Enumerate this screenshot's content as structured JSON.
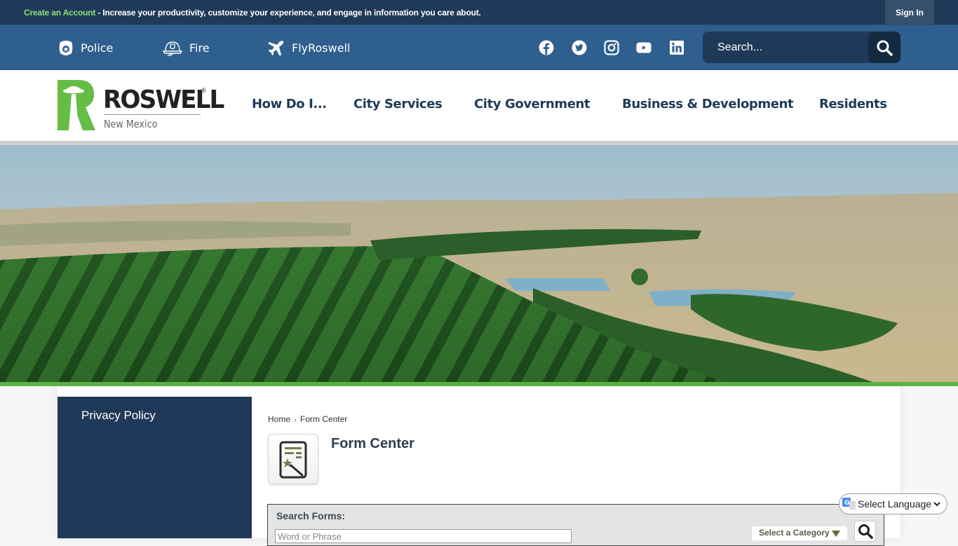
{
  "topbar": {
    "create_account_link": "Create an Account",
    "message": " - Increase your productivity, customize your experience, and engage in information you care about.",
    "sign_in_label": "Sign In"
  },
  "quicklinks": [
    {
      "label": "Police",
      "icon": "police-badge-icon"
    },
    {
      "label": "Fire",
      "icon": "fire-helmet-icon"
    },
    {
      "label": "FlyRoswell",
      "icon": "airplane-icon"
    }
  ],
  "social": [
    {
      "name": "facebook-icon"
    },
    {
      "name": "twitter-icon"
    },
    {
      "name": "instagram-icon"
    },
    {
      "name": "youtube-icon"
    },
    {
      "name": "linkedin-icon"
    }
  ],
  "search": {
    "placeholder": "Search...",
    "button_icon": "search-icon"
  },
  "logo": {
    "name": "ROSWELL",
    "subtitle": "New Mexico",
    "registered": "®"
  },
  "nav": [
    {
      "label": "How Do I..."
    },
    {
      "label": "City Services"
    },
    {
      "label": "City Government"
    },
    {
      "label": "Business & Development"
    },
    {
      "label": "Residents"
    }
  ],
  "colors": {
    "topbar": "#1f3a58",
    "utilbar": "#2e5f8e",
    "accent_green": "#5db446",
    "nav_text": "#1f3a58"
  },
  "sidebar": {
    "items": [
      {
        "label": "Privacy Policy"
      }
    ]
  },
  "breadcrumb": {
    "home": "Home",
    "separator": "›",
    "current": "Form Center"
  },
  "page": {
    "title": "Form Center"
  },
  "search_forms": {
    "label": "Search Forms:",
    "placeholder": "Word or Phrase",
    "category_selected": "Select a Category"
  },
  "language": {
    "selected": "Select Language"
  }
}
